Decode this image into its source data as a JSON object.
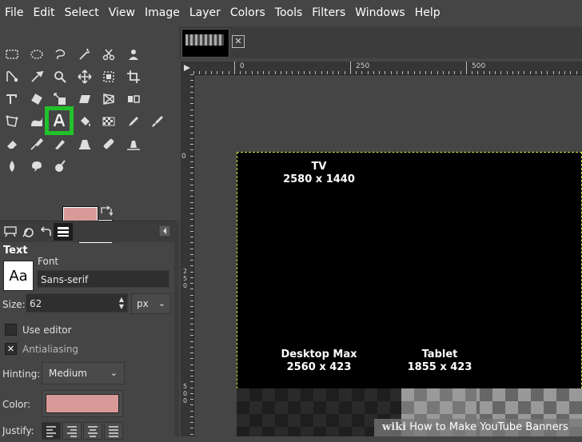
{
  "menubar": {
    "items": [
      "File",
      "Edit",
      "Select",
      "View",
      "Image",
      "Layer",
      "Colors",
      "Tools",
      "Filters",
      "Windows",
      "Help"
    ]
  },
  "toolbox": {
    "tools": [
      "rect-select-icon",
      "ellipse-select-icon",
      "lasso-icon",
      "fuzzy-select-icon",
      "scissors-icon",
      "foreground-select-icon",
      "paths-icon",
      "color-picker-icon",
      "zoom-icon",
      "move-icon",
      "align-icon",
      "crop-icon",
      "unified-transform-icon",
      "rotate-icon",
      "scale-icon",
      "shear-icon",
      "perspective-icon",
      "flip-icon",
      "cage-icon",
      "warp-icon",
      "text-tool-icon",
      "bucket-fill-icon",
      "blend-icon",
      "pencil-icon",
      "paintbrush-icon",
      "eraser-icon",
      "airbrush-icon",
      "ink-icon",
      "clone-icon",
      "heal-icon",
      "perspective-clone-icon",
      "blur-icon",
      "smudge-icon",
      "dodge-burn-icon"
    ],
    "active_tool": "text-tool-icon",
    "fg_color": "#d89a99",
    "bg_color": "#ffffff"
  },
  "text_options": {
    "title": "Text",
    "font_label": "Font",
    "font_preview": "Aa",
    "font_value": "Sans-serif",
    "size_label": "Size:",
    "size_value": "62",
    "unit": "px",
    "use_editor_label": "Use editor",
    "use_editor_checked": false,
    "antialiasing_label": "Antialiasing",
    "antialiasing_checked": true,
    "antialiasing_check": "✕",
    "hinting_label": "Hinting:",
    "hinting_value": "Medium",
    "color_label": "Color:",
    "text_color": "#d89a99",
    "justify_label": "Justify:"
  },
  "rulers": {
    "h_ticks": [
      "0",
      "250",
      "500"
    ],
    "v_ticks": [
      "0",
      "250",
      "500"
    ]
  },
  "canvas": {
    "labels": [
      {
        "title": "TV",
        "dims": "2580 x 1440"
      },
      {
        "title": "Desktop Max",
        "dims": "2560 x 423"
      },
      {
        "title": "Tablet",
        "dims": "1855 x 423"
      }
    ]
  },
  "watermark": {
    "brand": "wiki",
    "text": "How to Make YouTube Banners"
  }
}
